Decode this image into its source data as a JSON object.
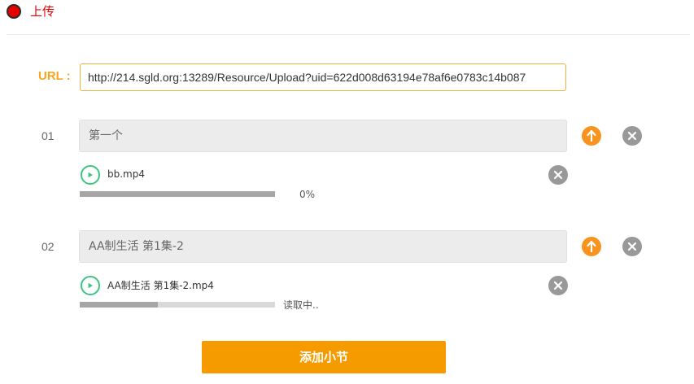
{
  "header": {
    "title": "上传",
    "icon": "record-dot-icon",
    "dot_color": "#e60000"
  },
  "url": {
    "label": "URL :",
    "value": "http://214.sgld.org:13289/Resource/Upload?uid=622d008d63194e78af6e0783c14b087"
  },
  "sections": [
    {
      "number": "01",
      "title": "第一个",
      "file": {
        "name": "bb.mp4",
        "progress": 0,
        "status": "0%"
      }
    },
    {
      "number": "02",
      "title": "AA制生活 第1集-2",
      "file": {
        "name": "AA制生活 第1集-2.mp4",
        "progress": 0.4,
        "status": "读取中.."
      }
    }
  ],
  "add_button": {
    "label": "添加小节"
  },
  "colors": {
    "accent": "#f59b00",
    "upload": "#f7931e",
    "close": "#999999",
    "play": "#3cc480",
    "url_label": "#f5a623"
  }
}
